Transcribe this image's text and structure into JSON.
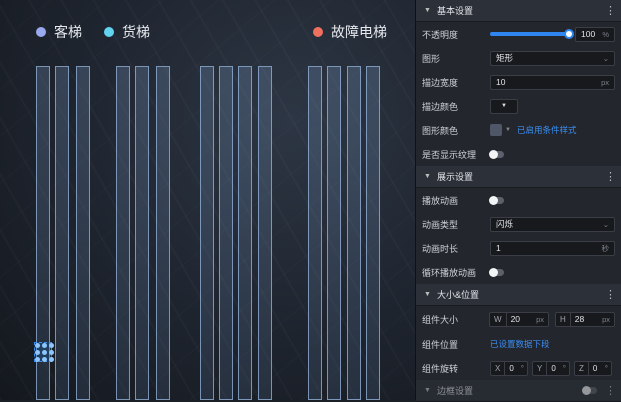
{
  "legend": [
    {
      "label": "客梯",
      "color": "#9aa8f0"
    },
    {
      "label": "货梯",
      "color": "#62d4f0"
    },
    {
      "label": "故障电梯",
      "color": "#f07060"
    }
  ],
  "bars_count": 13,
  "panel": {
    "basic": {
      "title": "基本设置",
      "opacity_label": "不透明度",
      "opacity_value": "100",
      "opacity_unit": "%",
      "opacity_fraction": 1.0,
      "shape_label": "图形",
      "shape_value": "矩形",
      "stroke_width_label": "描边宽度",
      "stroke_width_value": "10",
      "stroke_width_unit": "px",
      "stroke_color_label": "描边颜色",
      "fill_color_label": "图形颜色",
      "fill_color_link": "已启用条件样式",
      "texture_label": "是否显示纹理"
    },
    "display": {
      "title": "展示设置",
      "animate_label": "播放动画",
      "anim_type_label": "动画类型",
      "anim_type_value": "闪烁",
      "anim_duration_label": "动画时长",
      "anim_duration_value": "1",
      "anim_duration_unit": "秒",
      "loop_label": "循环播放动画"
    },
    "size": {
      "title": "大小&位置",
      "size_label": "组件大小",
      "w_prefix": "W",
      "w_value": "20",
      "w_unit": "px",
      "h_prefix": "H",
      "h_value": "28",
      "h_unit": "px",
      "position_label": "组件位置",
      "position_link": "已设置数据下段",
      "rotation_label": "组件旋转",
      "x_prefix": "X",
      "x_value": "0",
      "y_prefix": "Y",
      "y_value": "0",
      "z_prefix": "Z",
      "z_value": "0",
      "deg_unit": "°"
    },
    "border": {
      "title": "边框设置"
    }
  },
  "colors": {
    "accent": "#2f86f0",
    "link": "#3b8ff5"
  }
}
